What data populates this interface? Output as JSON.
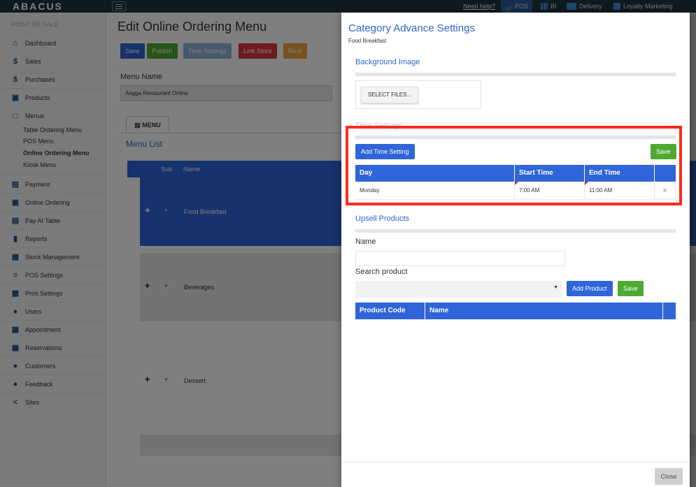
{
  "topbar": {
    "brand": "ABACUS",
    "help": "Need help?",
    "pos": "POS",
    "bi": "BI",
    "delivery": "Delivery",
    "loyalty": "Loyalty Marketing"
  },
  "sidebar": {
    "heading": "POINT OF SALE",
    "items": [
      {
        "label": "Dashboard",
        "icon": "home-icon"
      },
      {
        "label": "Sales",
        "icon": "dollar-icon"
      },
      {
        "label": "Purchases",
        "icon": "dollar-icon"
      },
      {
        "label": "Products",
        "icon": "cart-icon"
      },
      {
        "label": "Menus",
        "icon": "square-icon"
      },
      {
        "label": "Payment",
        "icon": "wallet-icon"
      },
      {
        "label": "Online Ordering",
        "icon": "cart-icon"
      },
      {
        "label": "Pay At Table",
        "icon": "wallet-icon"
      },
      {
        "label": "Reports",
        "icon": "bar-chart-icon"
      },
      {
        "label": "Stock Management",
        "icon": "stock-icon"
      },
      {
        "label": "POS Settings",
        "icon": "sliders-icon"
      },
      {
        "label": "Print Settings",
        "icon": "printer-icon"
      },
      {
        "label": "Users",
        "icon": "user-icon"
      },
      {
        "label": "Appointment",
        "icon": "calendar-icon"
      },
      {
        "label": "Reservations",
        "icon": "table-icon"
      },
      {
        "label": "Customers",
        "icon": "users-icon"
      },
      {
        "label": "Feedback",
        "icon": "user-icon"
      },
      {
        "label": "Sites",
        "icon": "share-icon"
      }
    ],
    "menu_subitems": [
      "Table Ordering Menu",
      "POS Menu",
      "Online Ordering Menu",
      "Kiosk Menu"
    ]
  },
  "main": {
    "title": "Edit Online Ordering Menu",
    "buttons": {
      "save": "Save",
      "publish": "Publish",
      "time": "Time Settings",
      "link": "Link Store",
      "back": "Back"
    },
    "menu_name_label": "Menu Name",
    "menu_name_value": "Angga Restaurant Online",
    "tab": "MENU",
    "list_title": "Menu List",
    "columns": {
      "sub": "Sub",
      "name": "Name"
    },
    "rows": [
      "Food Breakfast",
      "Beverages",
      "Dessert"
    ]
  },
  "modal": {
    "title": "Category Advance Settings",
    "subtitle": "Food Breakfast",
    "bg_header": "Background Image",
    "select_files": "SELECT FILES...",
    "time_header": "Time Settings",
    "add_time": "Add Time Setting",
    "save": "Save",
    "time_columns": {
      "day": "Day",
      "start": "Start Time",
      "end": "End Time"
    },
    "time_rows": [
      {
        "day": "Monday",
        "start": "7:00 AM",
        "end": "11:00 AM"
      }
    ],
    "upsell_header": "Upsell Products",
    "name_label": "Name",
    "search_label": "Search product",
    "add_product": "Add Product",
    "save2": "Save",
    "product_columns": {
      "code": "Product Code",
      "name": "Name"
    },
    "close": "Close",
    "remove_glyph": "×"
  },
  "colors": {
    "primary": "#2f65d8",
    "success": "#4ea933",
    "danger": "#d9363e",
    "warning": "#f0a43a",
    "highlight": "#ff2a1a"
  }
}
